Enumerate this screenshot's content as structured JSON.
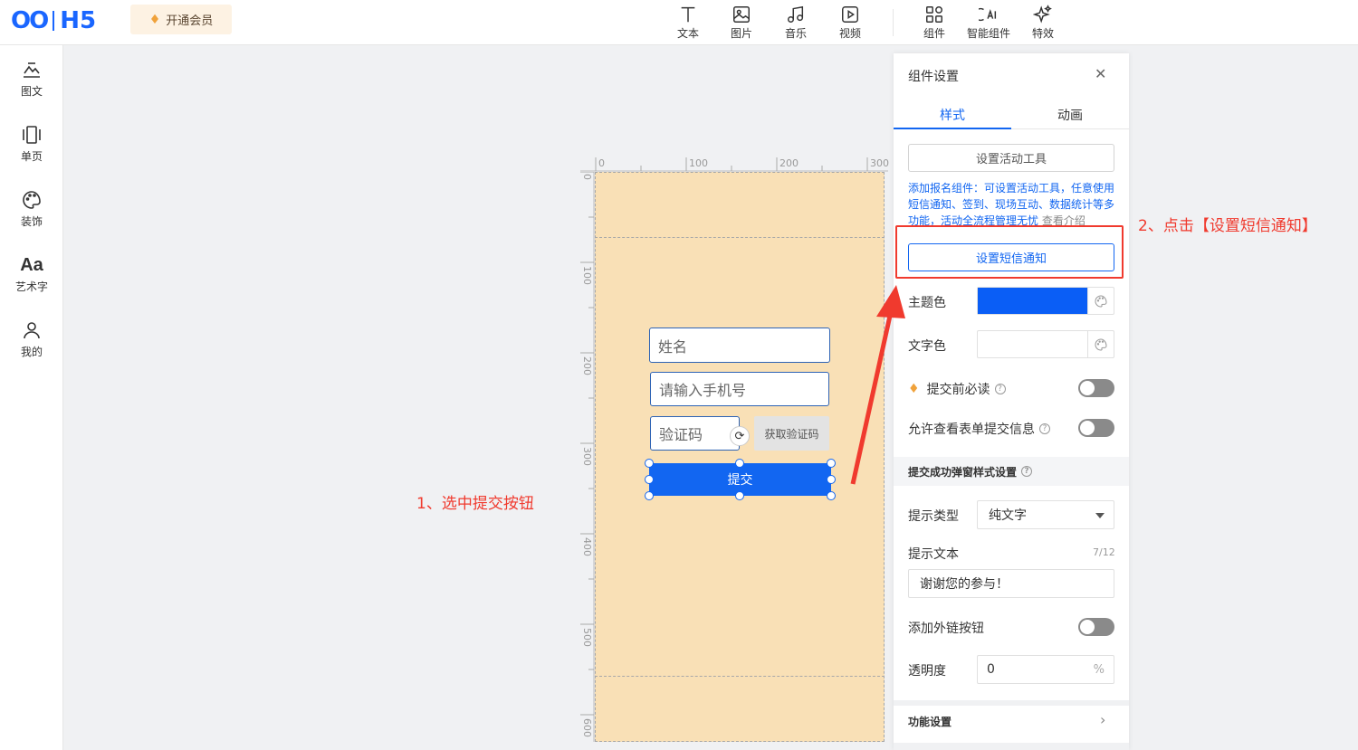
{
  "header": {
    "logo_mark": "OO",
    "logo_text": "H5",
    "vip_label": "开通会员",
    "tools": [
      {
        "label": "文本",
        "icon": "text-icon"
      },
      {
        "label": "图片",
        "icon": "image-icon"
      },
      {
        "label": "音乐",
        "icon": "music-icon"
      },
      {
        "label": "视频",
        "icon": "video-icon"
      },
      {
        "label": "组件",
        "icon": "components-icon"
      },
      {
        "label": "智能组件",
        "icon": "ai-components-icon"
      },
      {
        "label": "特效",
        "icon": "effects-icon"
      }
    ]
  },
  "sidebar": {
    "items": [
      {
        "label": "图文",
        "icon": "image-text-icon"
      },
      {
        "label": "单页",
        "icon": "single-page-icon"
      },
      {
        "label": "装饰",
        "icon": "palette-icon"
      },
      {
        "label": "艺术字",
        "icon": "art-text-icon",
        "glyph": "Aa"
      },
      {
        "label": "我的",
        "icon": "user-icon"
      }
    ]
  },
  "canvas": {
    "ruler_h": [
      "0",
      "100",
      "200",
      "300"
    ],
    "ruler_v": [
      "0",
      "100",
      "200",
      "300",
      "400",
      "500",
      "600"
    ],
    "form": {
      "name_placeholder": "姓名",
      "phone_placeholder": "请输入手机号",
      "code_placeholder": "验证码",
      "get_code_label": "获取验证码",
      "submit_label": "提交"
    },
    "page_color": "#f9e0b6"
  },
  "annotations": {
    "step1": "1、选中提交按钮",
    "step2": "2、点击【设置短信通知】",
    "color": "#f03a2e"
  },
  "panel": {
    "title": "组件设置",
    "tabs": [
      {
        "label": "样式",
        "active": true
      },
      {
        "label": "动画",
        "active": false
      }
    ],
    "activity_tool_button": "设置活动工具",
    "description": "添加报名组件：可设置活动工具，任意使用短信通知、签到、现场互动、数据统计等多功能，活动全流程管理无忧",
    "view_intro": "查看介绍",
    "sms_button": "设置短信通知",
    "theme_color_label": "主题色",
    "theme_color": "#0a5ef6",
    "text_color_label": "文字色",
    "must_read_label": "提交前必读",
    "allow_view_label": "允许查看表单提交信息",
    "popup_section": "提交成功弹窗样式设置",
    "hint_type_label": "提示类型",
    "hint_type_value": "纯文字",
    "hint_text_label": "提示文本",
    "hint_text_counter": "7/12",
    "hint_text_value": "谢谢您的参与！",
    "external_link_label": "添加外链按钮",
    "opacity_label": "透明度",
    "opacity_value": "0",
    "opacity_unit": "%",
    "function_settings": "功能设置"
  }
}
